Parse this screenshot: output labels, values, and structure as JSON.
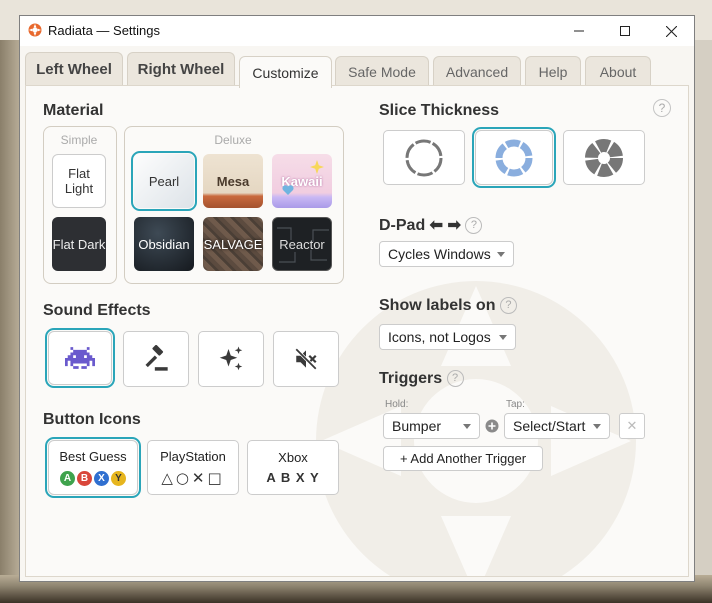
{
  "window": {
    "title": "Radiata — Settings"
  },
  "tabs": [
    {
      "label": "Left Wheel"
    },
    {
      "label": "Right Wheel"
    },
    {
      "label": "Customize"
    },
    {
      "label": "Safe Mode"
    },
    {
      "label": "Advanced"
    },
    {
      "label": "Help"
    },
    {
      "label": "About"
    }
  ],
  "material": {
    "heading": "Material",
    "simple_label": "Simple",
    "deluxe_label": "Deluxe",
    "flat_light": "Flat Light",
    "flat_dark": "Flat Dark",
    "pearl": "Pearl",
    "mesa": "Mesa",
    "kawaii": "Kawaii",
    "obsidian": "Obsidian",
    "salvage": "SALVAGE",
    "reactor": "Reactor",
    "selected": "Pearl"
  },
  "sound": {
    "heading": "Sound Effects",
    "options": [
      "space-invader-icon",
      "gavel-icon",
      "sparkles-icon",
      "mute-icon"
    ],
    "selected": "space-invader-icon"
  },
  "button_icons": {
    "heading": "Button Icons",
    "best_guess": "Best Guess",
    "best_guess_faces": [
      "A",
      "B",
      "X",
      "Y"
    ],
    "playstation": "PlayStation",
    "playstation_glyphs": "△○✕□",
    "xbox": "Xbox",
    "xbox_letters": "A B X Y",
    "selected": "Best Guess"
  },
  "slice": {
    "heading": "Slice Thickness",
    "help": "?",
    "selected": 1
  },
  "dpad": {
    "heading": "D-Pad ⬅ ➡",
    "help": "?",
    "value": "Cycles Windows"
  },
  "labels": {
    "heading": "Show labels on",
    "help": "?",
    "value": "Icons, not Logos"
  },
  "triggers": {
    "heading": "Triggers",
    "help": "?",
    "hold_label": "Hold:",
    "hold_value": "Bumper",
    "tap_label": "Tap:",
    "tap_value": "Select/Start",
    "add": "+ Add Another Trigger",
    "remove": "✕"
  },
  "colors": {
    "accent": "#2aa5b9",
    "face_a": "#3fa34d",
    "face_b": "#d9463a",
    "face_x": "#2f6fd0",
    "face_y": "#e6b51e"
  }
}
